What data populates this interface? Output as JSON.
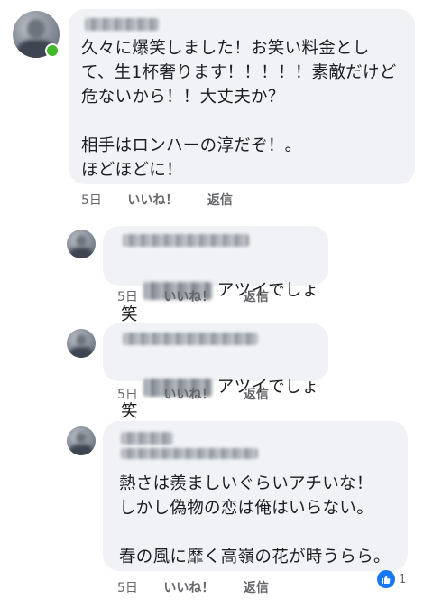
{
  "comments": [
    {
      "text": "久々に爆笑しました！お笑い料金として、生1杯奢ります！！！！！素敵だけど危ないから！！大丈夫か？\n\n相手はロンハーの淳だぞ！。\nほどほどに！",
      "time": "5日",
      "like_label": "いいね！",
      "reply_label": "返信"
    },
    {
      "text": "アツイでしょ笑",
      "time": "5日",
      "like_label": "いいね！",
      "reply_label": "返信"
    },
    {
      "text": "アツイでしょ笑",
      "time": "5日",
      "like_label": "いいね！",
      "reply_label": "返信"
    },
    {
      "text": "熱さは羨ましいぐらいアチいな！\nしかし偽物の恋は俺はいらない。\n\n春の風に靡く高嶺の花が時うらら。",
      "time": "5日",
      "like_label": "いいね！",
      "reply_label": "返信",
      "reactions": {
        "icon": "thumbs-up-icon",
        "count": "1"
      }
    }
  ],
  "colors": {
    "bubble": "#f0f2f5",
    "meta": "#65676b",
    "like_blue": "#1877f2",
    "online": "#42b72a"
  }
}
